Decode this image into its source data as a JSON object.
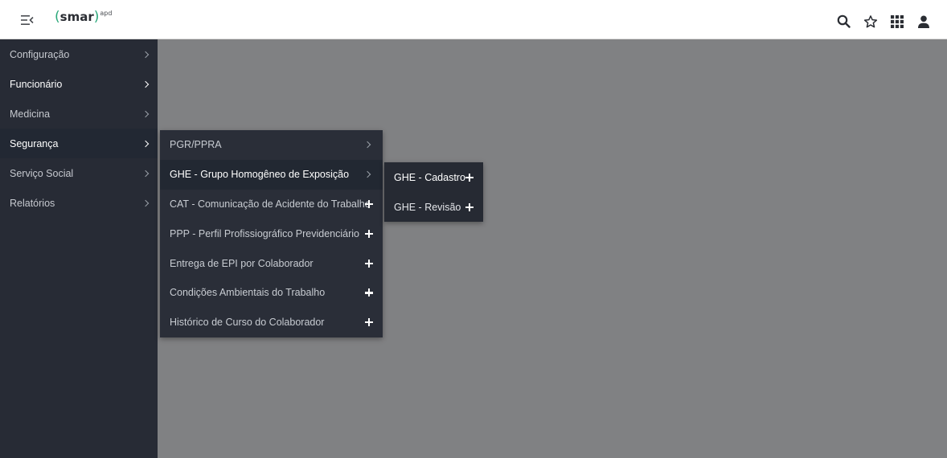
{
  "header": {
    "logo": {
      "paren_open": "(",
      "text": "smar",
      "paren_close": ")",
      "sup": "apd"
    },
    "icons": [
      "menu-toggle-icon",
      "search-icon",
      "star-icon",
      "apps-grid-icon",
      "user-icon"
    ]
  },
  "sidebar": {
    "items": [
      {
        "label": "Configuração"
      },
      {
        "label": "Funcionário"
      },
      {
        "label": "Medicina"
      },
      {
        "label": "Segurança"
      },
      {
        "label": "Serviço Social"
      },
      {
        "label": "Relatórios"
      }
    ]
  },
  "submenu": {
    "items": [
      {
        "label": "PGR/PPRA"
      },
      {
        "label": "GHE - Grupo Homogêneo de Exposição"
      },
      {
        "label": "CAT - Comunicação de Acidente do Trabalho"
      },
      {
        "label": "PPP - Perfil Profissiográfico Previdenciário"
      },
      {
        "label": "Entrega de EPI por Colaborador"
      },
      {
        "label": "Condições Ambientais do Trabalho"
      },
      {
        "label": "Histórico de Curso do Colaborador"
      }
    ]
  },
  "submenu2": {
    "items": [
      {
        "label": "GHE - Cadastro"
      },
      {
        "label": "GHE - Revisão"
      }
    ]
  },
  "colors": {
    "sidebar_bg": "#272b35",
    "overlay": "#808183",
    "brand_green": "#2aa87a"
  }
}
